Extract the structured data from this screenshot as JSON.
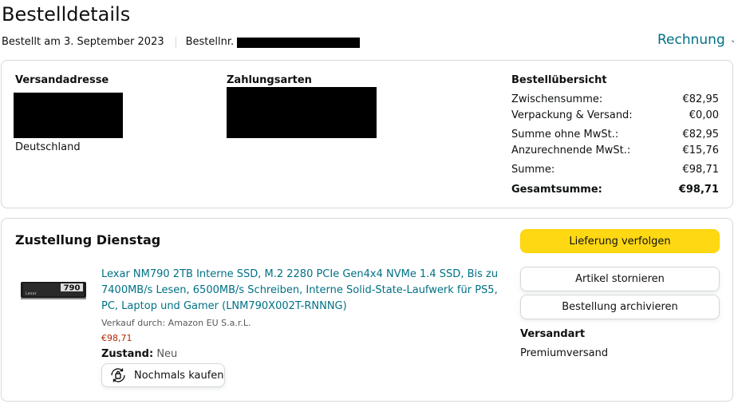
{
  "page": {
    "title": "Bestelldetails",
    "ordered_on": "Bestellt am 3. September 2023",
    "order_number_label": "Bestellnr.",
    "invoice_label": "Rechnung"
  },
  "summary_card": {
    "shipping_address_heading": "Versandadresse",
    "shipping_country": "Deutschland",
    "payment_heading": "Zahlungsarten",
    "overview_heading": "Bestellübersicht",
    "rows": [
      {
        "label": "Zwischensumme:",
        "value": "€82,95"
      },
      {
        "label": "Verpackung & Versand:",
        "value": "€0,00"
      },
      {
        "label": "Summe ohne MwSt.:",
        "value": "€82,95"
      },
      {
        "label": "Anzurechnende MwSt.:",
        "value": "€15,76"
      },
      {
        "label": "Summe:",
        "value": "€98,71"
      },
      {
        "label": "Gesamtsumme:",
        "value": "€98,71"
      }
    ]
  },
  "shipment": {
    "heading": "Zustellung Dienstag",
    "product": {
      "thumb_label": "790",
      "thumb_brand": "Lexar",
      "title": "Lexar NM790 2TB Interne SSD, M.2 2280 PCIe Gen4x4 NVMe 1.4 SSD, Bis zu 7400MB/s Lesen, 6500MB/s Schreiben, Interne Solid-State-Laufwerk für PS5, PC, Laptop und Gamer (LNM790X002T-RNNNG)",
      "seller": "Verkauf durch: Amazon EU S.a.r.L.",
      "price": "€98,71",
      "condition_label": "Zustand:",
      "condition_value": "Neu",
      "buy_again_label": "Nochmals kaufen"
    },
    "actions": {
      "track": "Lieferung verfolgen",
      "cancel": "Artikel stornieren",
      "archive": "Bestellung archivieren"
    },
    "shipping_method_heading": "Versandart",
    "shipping_method_value": "Premiumversand"
  },
  "colors": {
    "link": "#007185",
    "price": "#b12704",
    "primary_button": "#ffd814",
    "border": "#d5d9d9"
  },
  "icons": {
    "invoice_chevron": "chevron-down-icon",
    "buy_again": "reorder-icon"
  }
}
